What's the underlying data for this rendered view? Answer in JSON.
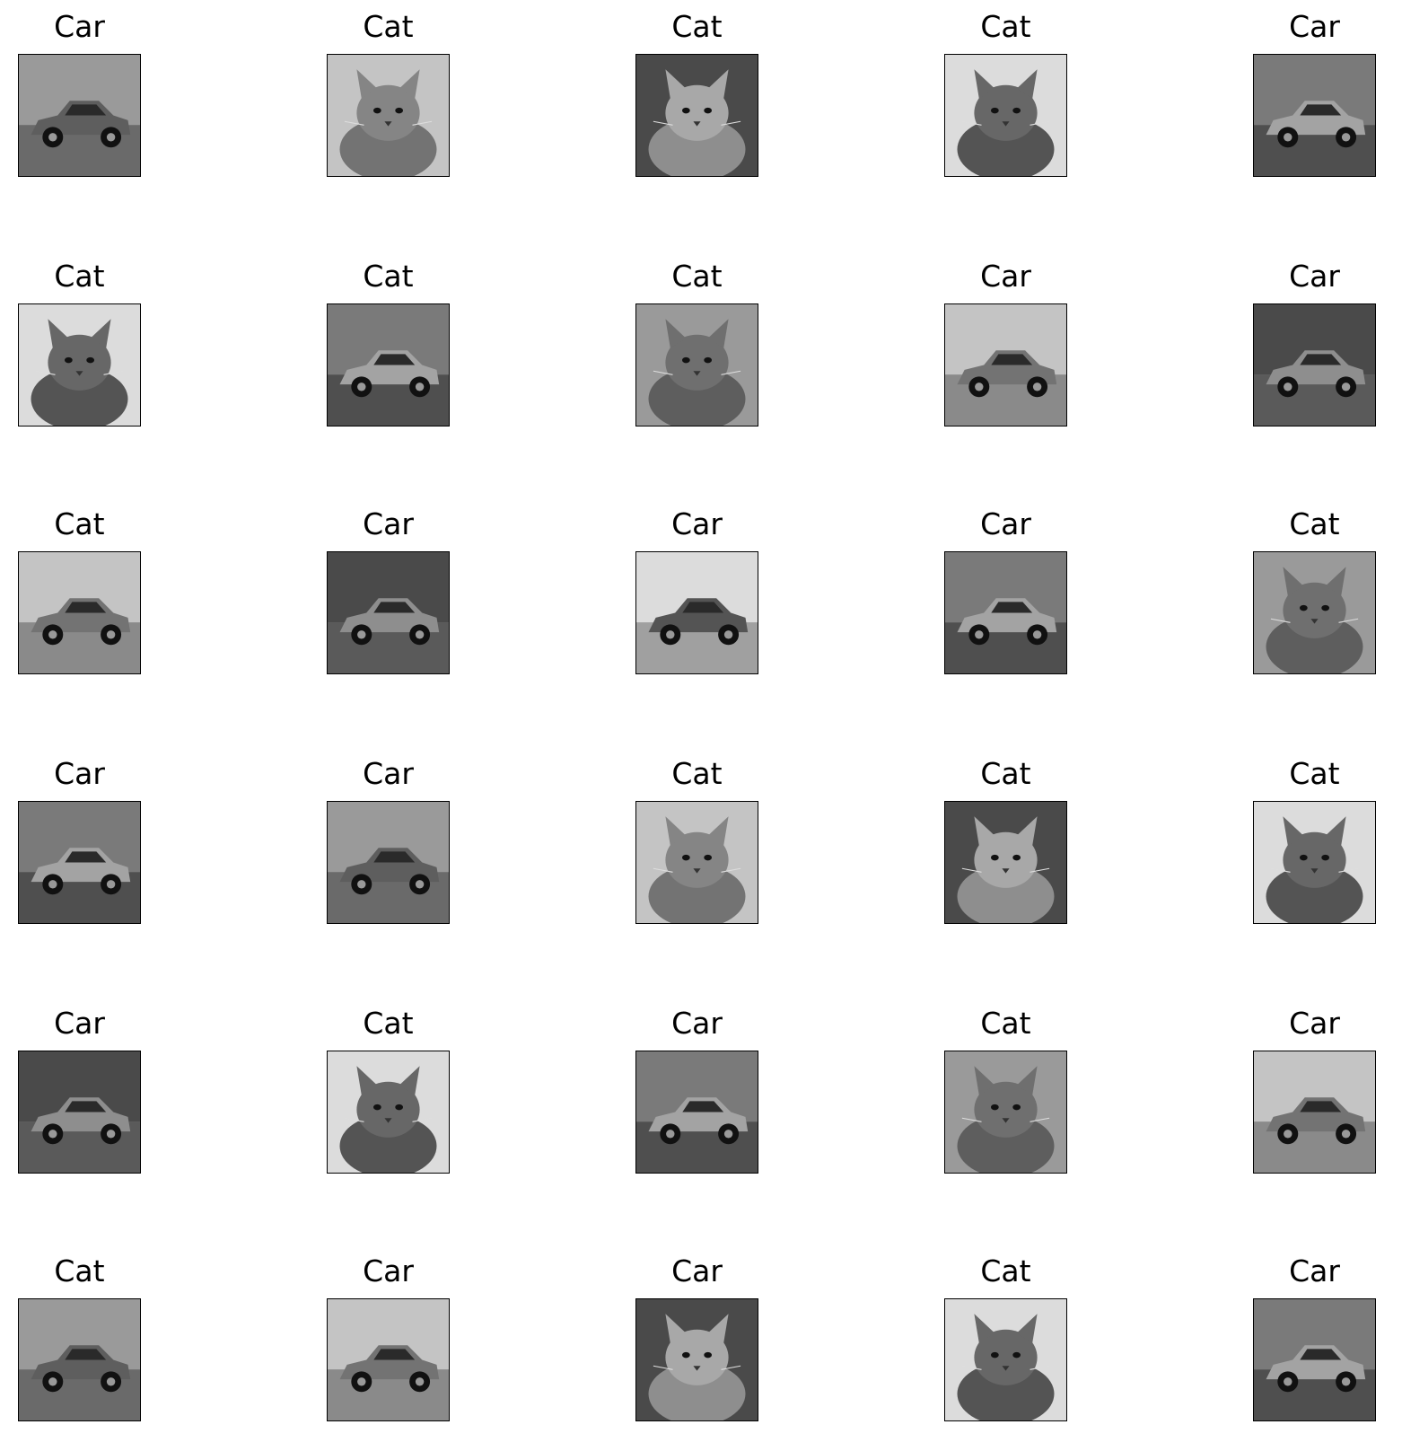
{
  "figure": {
    "rows": 6,
    "columns": 5,
    "image_style": "grayscale photographs",
    "tiles": [
      {
        "title": "Car",
        "subject": "car"
      },
      {
        "title": "Cat",
        "subject": "cat"
      },
      {
        "title": "Cat",
        "subject": "cat"
      },
      {
        "title": "Cat",
        "subject": "cat"
      },
      {
        "title": "Car",
        "subject": "car"
      },
      {
        "title": "Cat",
        "subject": "cat"
      },
      {
        "title": "Cat",
        "subject": "car"
      },
      {
        "title": "Cat",
        "subject": "cat"
      },
      {
        "title": "Car",
        "subject": "car"
      },
      {
        "title": "Car",
        "subject": "car"
      },
      {
        "title": "Cat",
        "subject": "car"
      },
      {
        "title": "Car",
        "subject": "car"
      },
      {
        "title": "Car",
        "subject": "car"
      },
      {
        "title": "Car",
        "subject": "car"
      },
      {
        "title": "Cat",
        "subject": "cat"
      },
      {
        "title": "Car",
        "subject": "car"
      },
      {
        "title": "Car",
        "subject": "car"
      },
      {
        "title": "Cat",
        "subject": "cat"
      },
      {
        "title": "Cat",
        "subject": "cat"
      },
      {
        "title": "Cat",
        "subject": "cat"
      },
      {
        "title": "Car",
        "subject": "car"
      },
      {
        "title": "Cat",
        "subject": "cat"
      },
      {
        "title": "Car",
        "subject": "car"
      },
      {
        "title": "Cat",
        "subject": "cat"
      },
      {
        "title": "Car",
        "subject": "car"
      },
      {
        "title": "Cat",
        "subject": "car"
      },
      {
        "title": "Car",
        "subject": "car"
      },
      {
        "title": "Car",
        "subject": "cat"
      },
      {
        "title": "Cat",
        "subject": "cat"
      },
      {
        "title": "Car",
        "subject": "car"
      }
    ]
  }
}
